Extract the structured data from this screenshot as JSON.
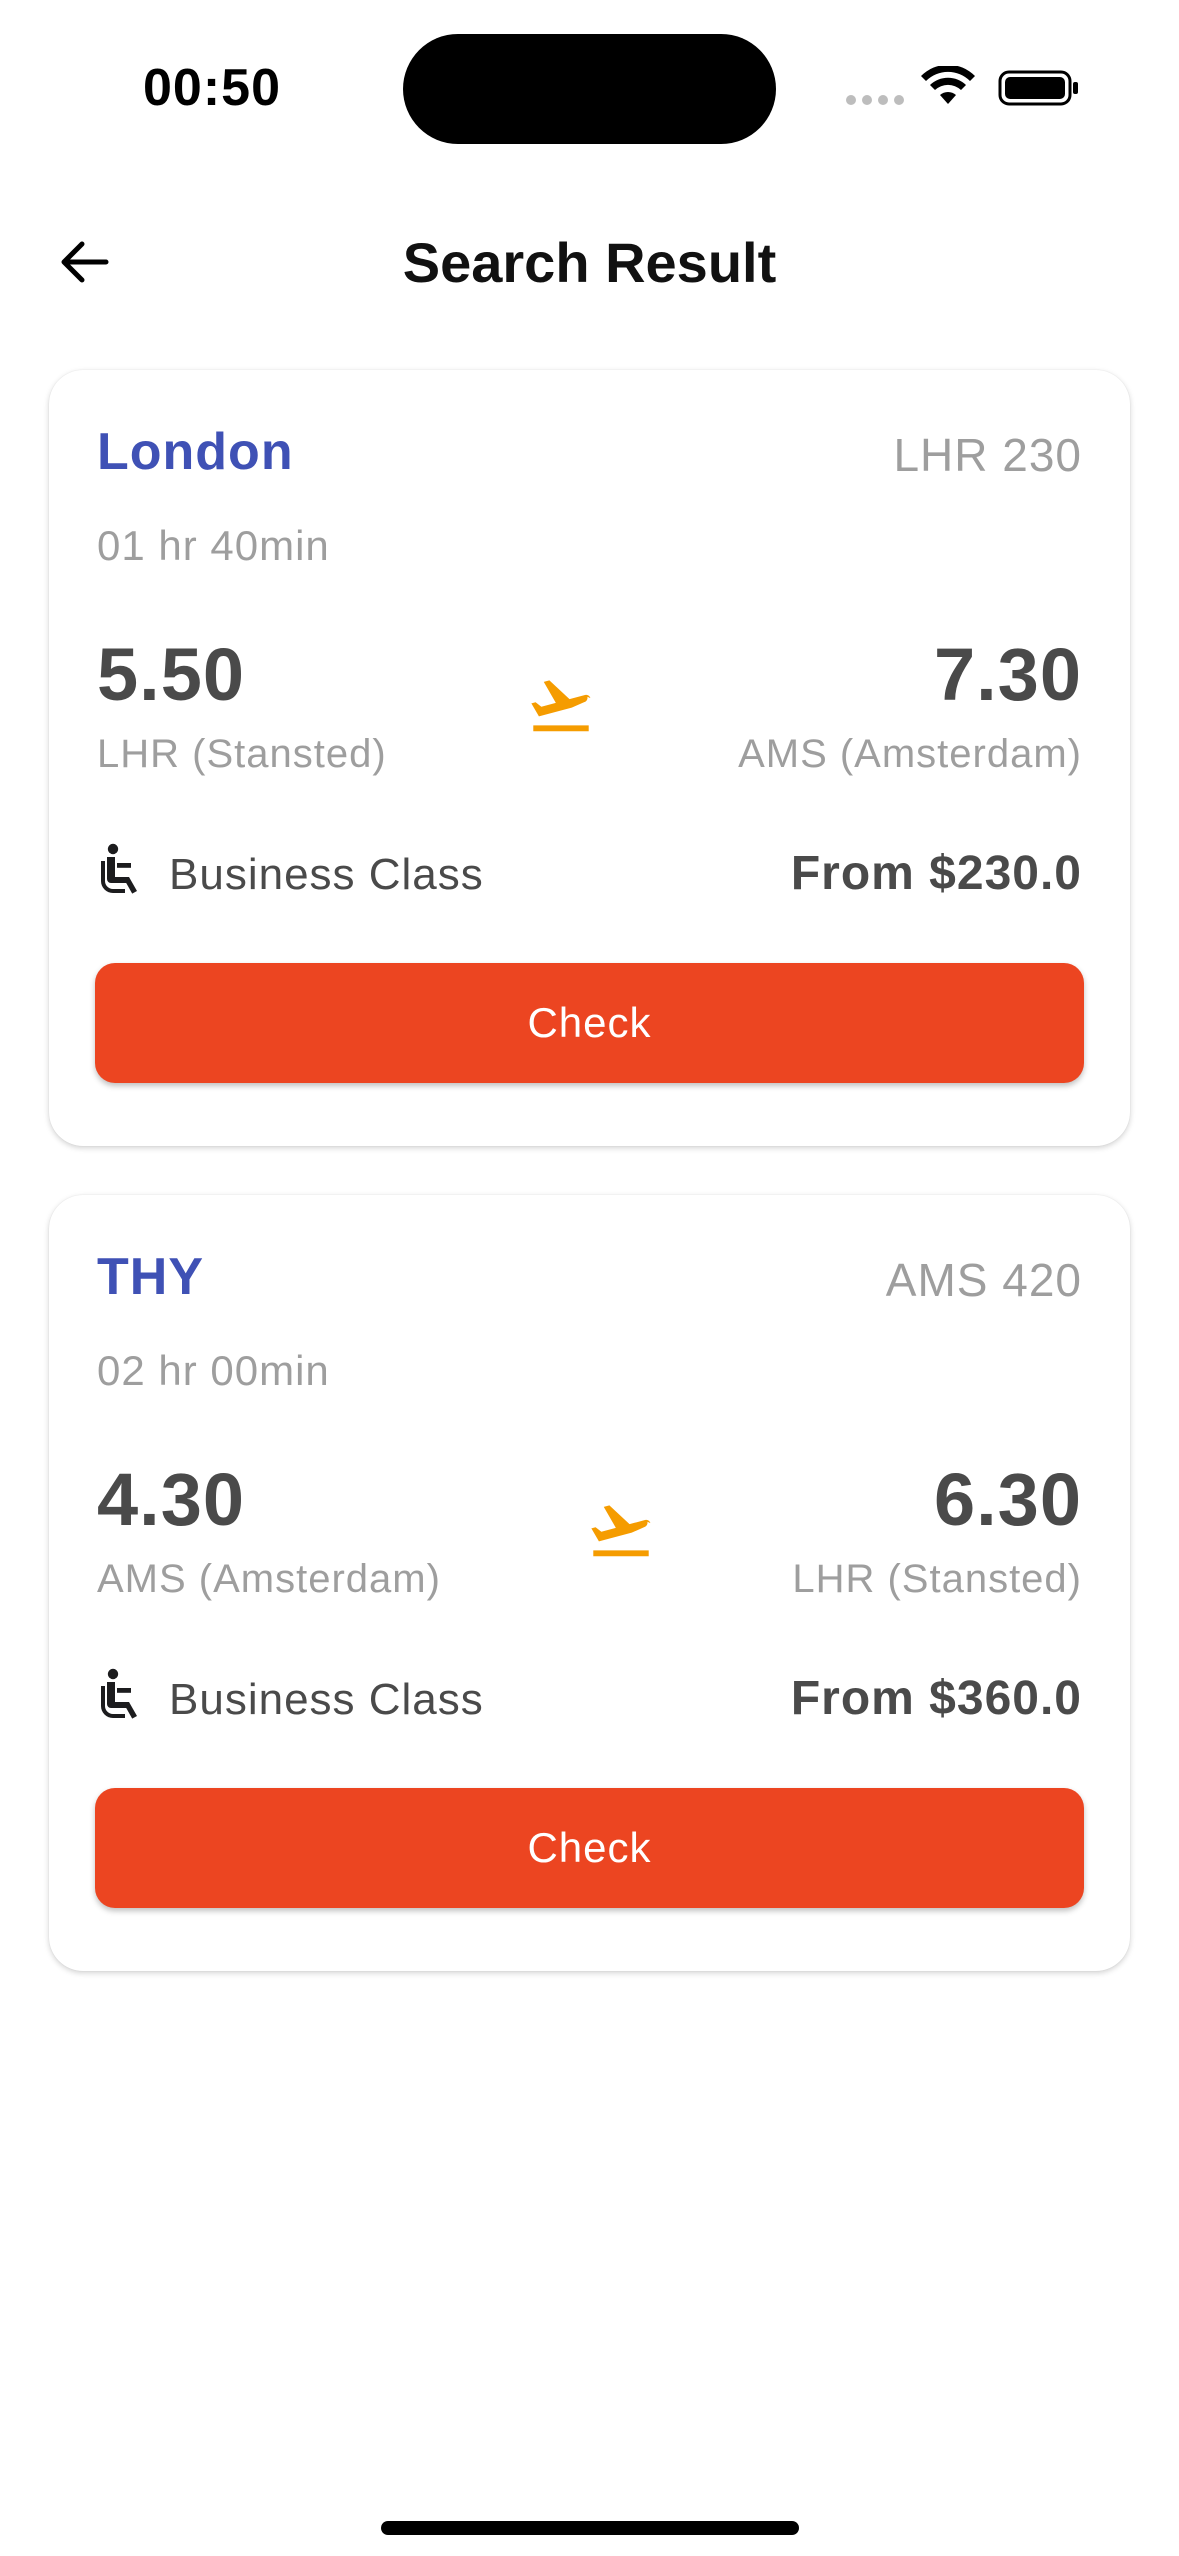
{
  "status_bar": {
    "time": "00:50",
    "icons": [
      "cellular-signal-icon",
      "wifi-icon",
      "battery-icon"
    ]
  },
  "header": {
    "back_icon": "arrow-left-icon",
    "title": "Search Result"
  },
  "colors": {
    "airline": "#3f51b5",
    "accent_button": "#ec4521",
    "plane_icon": "#f59c00",
    "muted_text": "#9e9e9e",
    "strong_text": "#4a4a4a"
  },
  "results": [
    {
      "airline": "London",
      "flight_code": "LHR 230",
      "duration": "01 hr 40min",
      "departure_time": "5.50",
      "departure_airport": "LHR (Stansted)",
      "arrival_time": "7.30",
      "arrival_airport": "AMS (Amsterdam)",
      "class_icon": "airline-seat-icon",
      "class_label": "Business Class",
      "price": "From $230.0",
      "button_label": "Check"
    },
    {
      "airline": "THY",
      "flight_code": "AMS 420",
      "duration": "02 hr 00min",
      "departure_time": "4.30",
      "departure_airport": "AMS (Amsterdam)",
      "arrival_time": "6.30",
      "arrival_airport": "LHR (Stansted)",
      "class_icon": "airline-seat-icon",
      "class_label": "Business Class",
      "price": "From $360.0",
      "button_label": "Check"
    }
  ]
}
